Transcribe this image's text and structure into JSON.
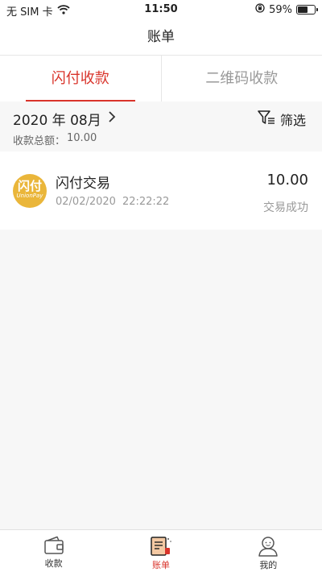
{
  "status_bar": {
    "carrier": "无 SIM 卡",
    "time": "11:50",
    "battery_percent": "59%",
    "battery_level": 0.59
  },
  "nav": {
    "title": "账单"
  },
  "tabs": [
    {
      "label": "闪付收款",
      "active": true
    },
    {
      "label": "二维码收款",
      "active": false
    }
  ],
  "summary": {
    "month": "2020 年 08月",
    "filter_label": "筛选",
    "total_label": "收款总额：",
    "total_value": "10.00"
  },
  "transactions": [
    {
      "logo_text": "闪付",
      "logo_sub": "UnionPay",
      "title": "闪付交易",
      "date": "02/02/2020",
      "time": "22:22:22",
      "amount": "10.00",
      "status": "交易成功"
    }
  ],
  "tabbar": [
    {
      "label": "收款",
      "icon": "wallet-icon",
      "active": false
    },
    {
      "label": "账单",
      "icon": "bill-icon",
      "active": true
    },
    {
      "label": "我的",
      "icon": "user-icon",
      "active": false
    }
  ],
  "colors": {
    "accent": "#d9342b",
    "logo": "#eab63a"
  }
}
